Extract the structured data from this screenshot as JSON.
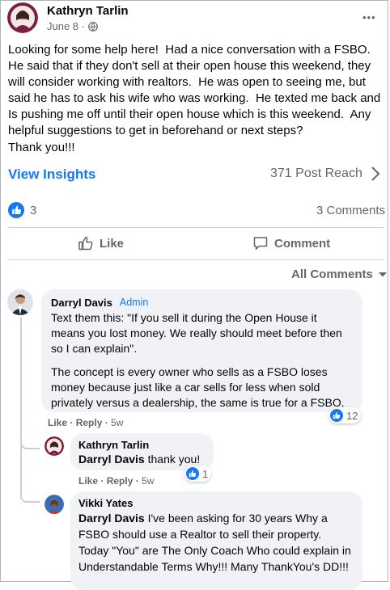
{
  "post": {
    "author": "Kathryn Tarlin",
    "date": "June 8",
    "date_sep": "·",
    "body_text": "Looking for some help here!  Had a nice conversation with a FSBO.  He said that if they don't sell at their open house this weekend, they will consider working with realtors.  He was open to seeing me, but said he has to ask his wife who was working.  He texted me back and Is pushing me off until their open house which is this weekend.  Any helpful suggestions to get in beforehand or next steps?",
    "thanks": "Thank you!!!",
    "more": "•••"
  },
  "insights": {
    "link": "View Insights",
    "reach": "371 Post Reach"
  },
  "stats": {
    "likes": "3",
    "comments": "3 Comments"
  },
  "actions": {
    "like": "Like",
    "comment": "Comment"
  },
  "filter": {
    "label": "All Comments"
  },
  "comments": [
    {
      "author": "Darryl Davis",
      "badge": "Admin",
      "paragraphs": [
        "Text them this: \"If you sell it during the Open House it means you lost money. We really should meet before then so I can explain\".",
        "The concept is every owner who sells as a FSBO loses money because just like a car sells for less when sold privately versus a dealership, the same is true for a FSBO."
      ],
      "like": "Like",
      "reply": "Reply",
      "time": "5w",
      "reactions": "12"
    },
    {
      "author": "Kathryn Tarlin",
      "mention": "Darryl Davis",
      "text": " thank you!",
      "like": "Like",
      "reply": "Reply",
      "time": "5w",
      "reactions": "1"
    },
    {
      "author": "Vikki Yates",
      "mention": "Darryl Davis",
      "text": " I've been asking for 30 years Why a FSBO should use a Realtor to sell their property. Today \"You\" are The Only Coach Who could explain in Understandable Terms Why!!! Many ThankYou's DD!!!"
    }
  ],
  "colors": {
    "accent": "#1877f2",
    "muted": "#65676b",
    "bubble": "#f0f2f5"
  },
  "icons": [
    "more-icon",
    "chevron-right-icon",
    "like-reaction-icon",
    "thumbs-up-icon",
    "comment-icon",
    "caret-down-icon"
  ]
}
